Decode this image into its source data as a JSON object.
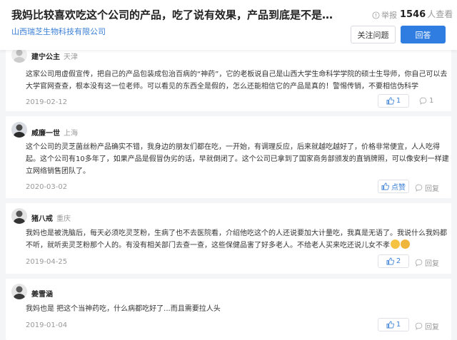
{
  "question": {
    "title": "我妈比较喜欢吃这个公司的产品，吃了说有效果，产品到底是不是所说的效...",
    "company": "山西瑞芝生物科技有限公司",
    "report_label": "举报",
    "view_count": "1546",
    "view_suffix": "人查看",
    "follow_label": "关注问题",
    "answer_label": "回答"
  },
  "answers": [
    {
      "author": "建宁公主",
      "location": "天津",
      "content": "这家公司用虚假宣传，把自己的产品包装成包治百病的“神药”，它的老板说自己是山西大学生命科学学院的硕士生导师，你自己可以去大学官网查查，根本没有这一位老师。可以看见的东西全是假的，怎么还能相信它的产品是真的！警惕传销，不要相信伪科学",
      "date": "2019-02-12",
      "like_label": "1",
      "reply_label": "1"
    },
    {
      "author": "威廉一世",
      "location": "上海",
      "content": "这个公司的灵芝菌丝粉产品确实不错，我身边的朋友们都在吃，一开始，有调理反应，后来就越吃越好了，价格非常便宜，人人吃得起。这个公司有10多年了，如果产品是假冒伪劣的话，早就倒闭了。这个公司已拿到了国家商务部颁发的直销牌照，可以像安利一样建立网络销售团队了。",
      "date": "2020-03-02",
      "like_label": "点赞",
      "reply_label": "回复"
    },
    {
      "author": "猪八戒",
      "location": "重庆",
      "content": "我妈也是被洗脑后，每天必须吃灵芝粉，生病了也不去医院看，介绍他吃这个的人还说要加大计量吃，我真是无语了。我说什么我妈都不听，就听卖灵芝粉那个人的。有没有相关部门去查一查，这些保健品害了好多老人。不给老人买来吃还说儿女不孝",
      "date": "2019-04-25",
      "like_label": "2",
      "reply_label": "回复",
      "emojis": [
        "crying-face",
        "weary-face"
      ]
    },
    {
      "author": "姜雪涵",
      "location": "",
      "content": "我妈也是 把这个当神药吃，什么病都吃好了...而且需要拉人头",
      "date": "2019-01-04",
      "like_label": "1",
      "reply_label": "回复"
    }
  ],
  "colors": {
    "accent": "#2f7de1",
    "link": "#3a7fd5",
    "muted": "#999999"
  }
}
